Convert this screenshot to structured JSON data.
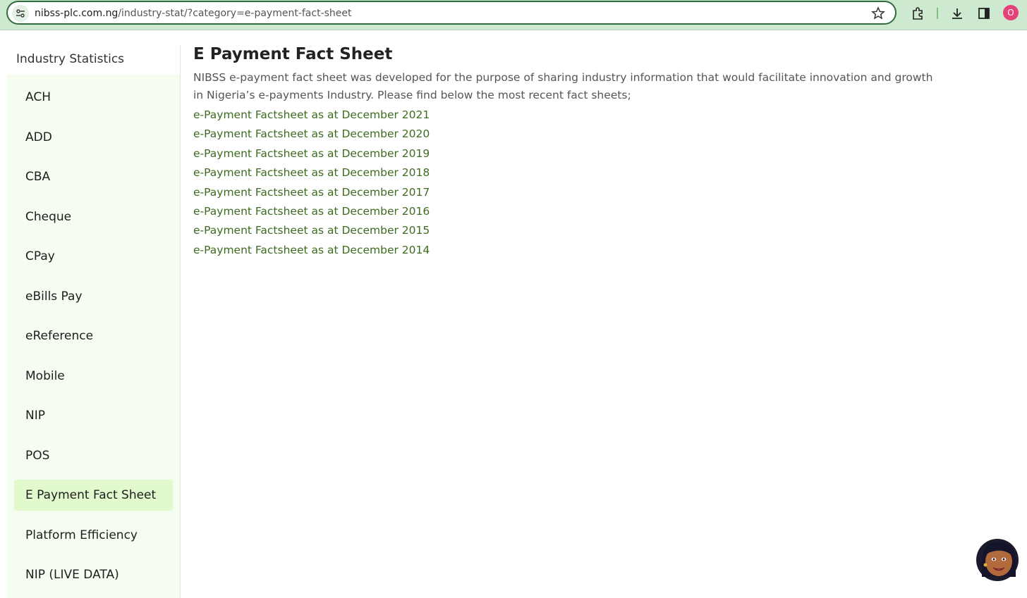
{
  "browser": {
    "url_host": "nibss-plc.com.ng",
    "url_path": "/industry-stat/?category=e-payment-fact-sheet",
    "profile_initial": "O"
  },
  "sidebar": {
    "title": "Industry Statistics",
    "items": [
      {
        "label": "ACH"
      },
      {
        "label": "ADD"
      },
      {
        "label": "CBA"
      },
      {
        "label": "Cheque"
      },
      {
        "label": "CPay"
      },
      {
        "label": "eBills Pay"
      },
      {
        "label": "eReference"
      },
      {
        "label": "Mobile"
      },
      {
        "label": "NIP"
      },
      {
        "label": "POS"
      },
      {
        "label": "E Payment Fact Sheet",
        "active": true
      },
      {
        "label": "Platform Efficiency"
      },
      {
        "label": "NIP (LIVE DATA)"
      }
    ]
  },
  "main": {
    "title": "E Payment Fact Sheet",
    "intro": "NIBSS e-payment fact sheet was developed for the purpose of sharing industry information that would facilitate innovation and growth in Nigeria’s e-payments Industry. Please find below the most recent fact sheets;",
    "links": [
      "e-Payment Factsheet as at December 2021",
      "e-Payment Factsheet as at December 2020",
      "e-Payment Factsheet as at December 2019",
      "e-Payment Factsheet as at December 2018",
      "e-Payment Factsheet as at December 2017",
      "e-Payment Factsheet as at December 2016",
      "e-Payment Factsheet as at December 2015",
      "e-Payment Factsheet as at December 2014"
    ]
  },
  "colors": {
    "link": "#3d6b20",
    "sidebar_bg": "#f5fdf0",
    "active_bg": "#e2f8cd",
    "chrome_bg": "#cde9cf"
  }
}
